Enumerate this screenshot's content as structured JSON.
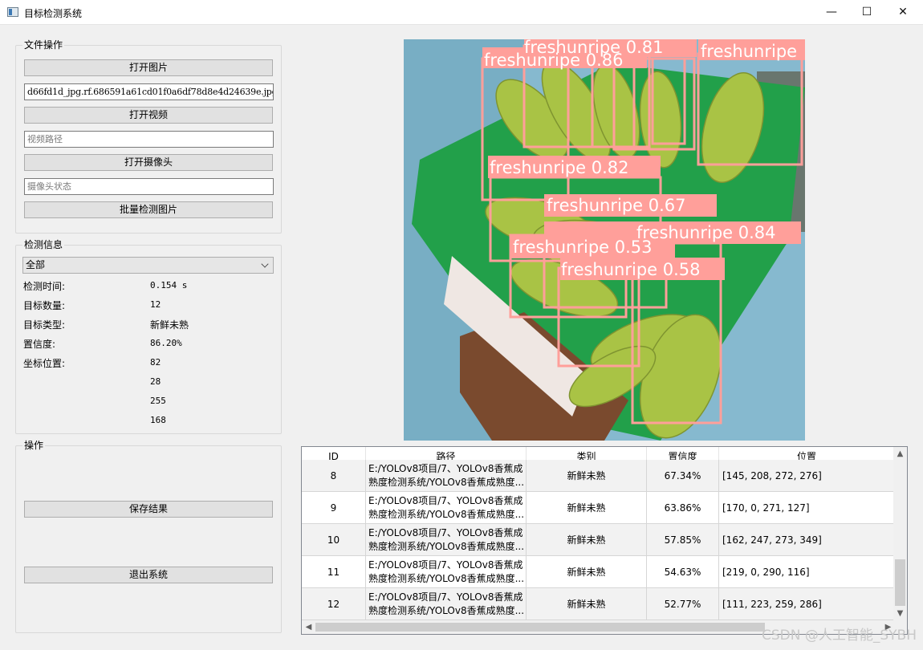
{
  "window": {
    "title": "目标检测系统",
    "minimize": "—",
    "maximize": "☐",
    "close": "✕"
  },
  "file_ops": {
    "title": "文件操作",
    "open_image": "打开图片",
    "image_path": "d66fd1d_jpg.rf.686591a61cd01f0a6df78d8e4d24639e.jpg",
    "open_video": "打开视频",
    "video_placeholder": "视频路径",
    "open_camera": "打开摄像头",
    "camera_placeholder": "摄像头状态",
    "batch_detect": "批量检测图片"
  },
  "detect_info": {
    "title": "检测信息",
    "filter": "全部",
    "time_label": "检测时间:",
    "time_value": "0.154 s",
    "count_label": "目标数量:",
    "count_value": "12",
    "type_label": "目标类型:",
    "type_value": "新鲜未熟",
    "conf_label": "置信度:",
    "conf_value": "86.20%",
    "coord_label": "坐标位置:",
    "coords": [
      "82",
      "28",
      "255",
      "168"
    ]
  },
  "operations": {
    "title": "操作",
    "save": "保存结果",
    "exit": "退出系统"
  },
  "image": {
    "labels": [
      "freshunripe 0.86",
      "freshunripe 0.81",
      "freshunripe",
      "freshunripe 0.82",
      "freshunripe 0.67",
      "freshunripe 0.84",
      "freshunripe 0.53",
      "freshunripe 0.58"
    ],
    "box_color": "#ff9f9a"
  },
  "table": {
    "headers": [
      "ID",
      "路径",
      "类别",
      "置信度",
      "位置"
    ],
    "rows": [
      {
        "id": "8",
        "path1": "E:/YOLOv8项目/7、YOLOv8香蕉成",
        "path2": "熟度检测系统/YOLOv8香蕉成熟度...",
        "cls": "新鲜未熟",
        "conf": "67.34%",
        "pos": "[145, 208, 272, 276]"
      },
      {
        "id": "9",
        "path1": "E:/YOLOv8项目/7、YOLOv8香蕉成",
        "path2": "熟度检测系统/YOLOv8香蕉成熟度...",
        "cls": "新鲜未熟",
        "conf": "63.86%",
        "pos": "[170, 0, 271, 127]"
      },
      {
        "id": "10",
        "path1": "E:/YOLOv8项目/7、YOLOv8香蕉成",
        "path2": "熟度检测系统/YOLOv8香蕉成熟度...",
        "cls": "新鲜未熟",
        "conf": "57.85%",
        "pos": "[162, 247, 273, 349]"
      },
      {
        "id": "11",
        "path1": "E:/YOLOv8项目/7、YOLOv8香蕉成",
        "path2": "熟度检测系统/YOLOv8香蕉成熟度...",
        "cls": "新鲜未熟",
        "conf": "54.63%",
        "pos": "[219, 0, 290, 116]"
      },
      {
        "id": "12",
        "path1": "E:/YOLOv8项目/7、YOLOv8香蕉成",
        "path2": "熟度检测系统/YOLOv8香蕉成熟度...",
        "cls": "新鲜未熟",
        "conf": "52.77%",
        "pos": "[111, 223, 259, 286]"
      }
    ]
  },
  "watermark": "CSDN @人工智能_SYBH"
}
